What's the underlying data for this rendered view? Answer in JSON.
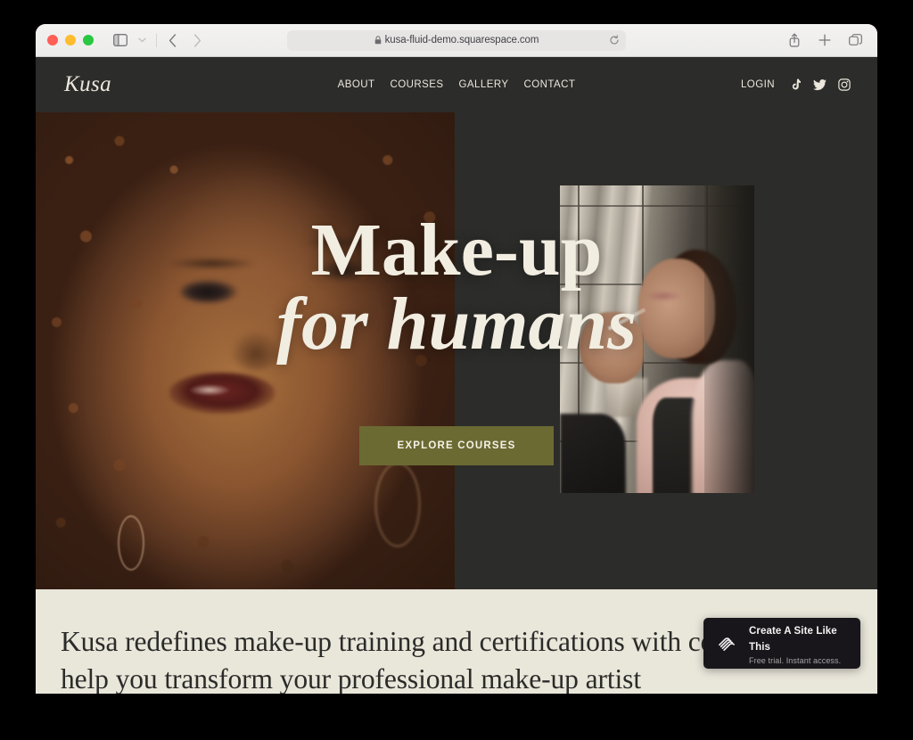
{
  "browser": {
    "url": "kusa-fluid-demo.squarespace.com",
    "lock_icon": "lock-icon",
    "reload_icon": "reload-icon",
    "sidebar_icon": "sidebar-toggle-icon",
    "dropdown_icon": "chevron-down-icon",
    "back_icon": "chevron-left-icon",
    "forward_icon": "chevron-right-icon",
    "share_icon": "share-icon",
    "newtab_icon": "plus-icon",
    "tabs_icon": "tab-overview-icon",
    "traffic_lights": [
      "close",
      "minimize",
      "maximize"
    ]
  },
  "site": {
    "logo": "Kusa",
    "nav": [
      {
        "label": "ABOUT"
      },
      {
        "label": "COURSES"
      },
      {
        "label": "GALLERY"
      },
      {
        "label": "CONTACT"
      }
    ],
    "login_label": "LOGIN",
    "social": [
      {
        "name": "tiktok-icon"
      },
      {
        "name": "twitter-icon"
      },
      {
        "name": "instagram-icon"
      }
    ],
    "hero": {
      "title_line1": "Make-up",
      "title_line2": "for humans",
      "cta_label": "EXPLORE COURSES",
      "left_image_alt": "portrait of woman with curly auburn hair and glossy lips",
      "right_image_alt": "make-up artist applying eye make-up to seated client in pink fur coat"
    },
    "intro": {
      "paragraph": "Kusa redefines make-up training and certifications with courses to help you transform your professional make-up artist"
    }
  },
  "badge": {
    "logo_icon": "squarespace-logo-icon",
    "title": "Create A Site Like This",
    "subtitle": "Free trial. Instant access."
  },
  "colors": {
    "header_bg": "#2c2c2a",
    "cream": "#e9e6da",
    "text_cream": "#ece7dc",
    "cta_olive": "#6b6a33",
    "badge_bg": "#18161a"
  }
}
